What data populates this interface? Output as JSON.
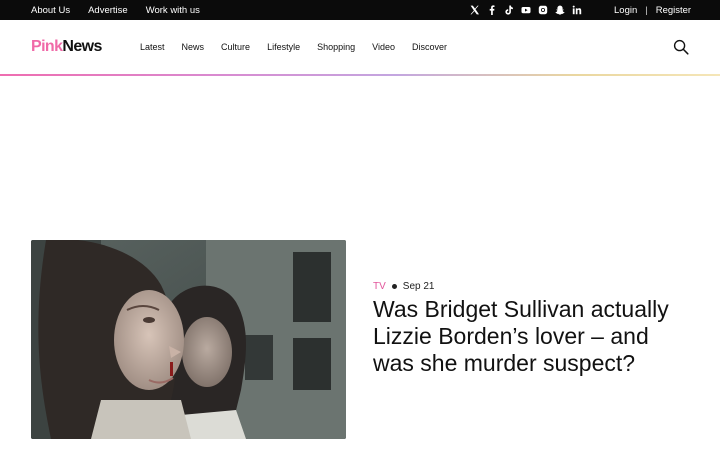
{
  "topbar": {
    "links": [
      "About Us",
      "Advertise",
      "Work with us"
    ],
    "social_icons": [
      "x-icon",
      "facebook-icon",
      "tiktok-icon",
      "youtube-icon",
      "instagram-icon",
      "snapchat-icon",
      "linkedin-icon"
    ],
    "login": "Login",
    "separator": "|",
    "register": "Register"
  },
  "brand": {
    "part1": "Pink",
    "part2": "News",
    "accent_color": "#f06aa8"
  },
  "nav": {
    "items": [
      "Latest",
      "News",
      "Culture",
      "Lifestyle",
      "Shopping",
      "Video",
      "Discover"
    ],
    "search_icon": "search-icon"
  },
  "article": {
    "category": "TV",
    "date": "Sep 21",
    "headline": "Was Bridget Sullivan actually Lizzie Borden’s lover – and was she murder suspect?",
    "category_color": "#e2559b"
  }
}
